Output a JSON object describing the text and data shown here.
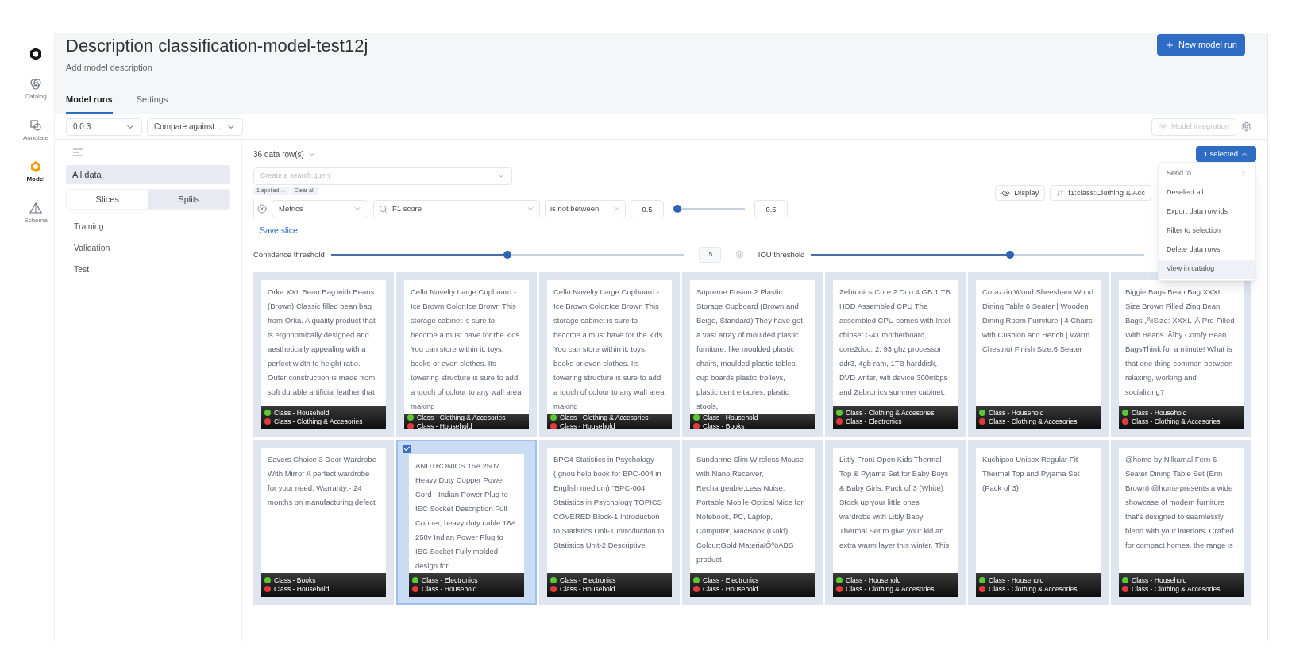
{
  "rail": [
    {
      "label": "Catalog",
      "selected": false,
      "kind": "catalog"
    },
    {
      "label": "Annotate",
      "selected": false,
      "kind": "annotate"
    },
    {
      "label": "Model",
      "selected": true,
      "kind": "model"
    },
    {
      "label": "Schema",
      "selected": false,
      "kind": "schema"
    }
  ],
  "header": {
    "title": "Description classification-model-test12j",
    "subtitle": "Add model description",
    "new_run": "New model run"
  },
  "tabs": [
    {
      "label": "Model runs",
      "selected": true
    },
    {
      "label": "Settings",
      "selected": false
    }
  ],
  "toolbar": {
    "version": "0.0.3",
    "compare": "Compare against...",
    "integration": "Model integration"
  },
  "sidebar": {
    "all_data": "All data",
    "segments": [
      {
        "label": "Slices",
        "selected": false
      },
      {
        "label": "Splits",
        "selected": true
      }
    ],
    "splits": [
      "Training",
      "Validation",
      "Test"
    ]
  },
  "rows_count": "36 data row(s)",
  "search": {
    "placeholder": "Create a search query",
    "applied": "1 applied",
    "clear": "Clear all"
  },
  "filter": {
    "field": "Metrics",
    "metric": "F1 score",
    "operator": "is not between",
    "min": "0.5",
    "max": "0.5",
    "level": 0.0
  },
  "save_slice": "Save slice",
  "display": "Display",
  "sort": "f1:class:Clothing & Acc",
  "selected_button": "1 selected",
  "menu": [
    {
      "label": "Send to",
      "kind": "submenu",
      "selected": false
    },
    {
      "label": "Deselect all",
      "kind": "item",
      "selected": false
    },
    {
      "label": "Export data row ids",
      "kind": "item",
      "selected": false
    },
    {
      "label": "Filter to selection",
      "kind": "item",
      "selected": false
    },
    {
      "label": "Delete data rows",
      "kind": "item",
      "selected": false
    },
    {
      "label": "View in catalog",
      "kind": "item",
      "selected": true
    }
  ],
  "confidence": {
    "label": "Confidence threshold",
    "level": 0.5,
    "value": ".5"
  },
  "iou": {
    "label": "IOU threshold",
    "level": 0.6
  },
  "cards": [
    {
      "text": "Orka XXL Bean Bag with Beans (Brown) Classic filled bean bag from Orka. A quality product that is ergonomically designed and aesthetically appealing with a perfect width to height ratio. Outer construction is made from soft durable artificial leather that",
      "selected": false,
      "labels": [
        {
          "text": "Class - Household",
          "color": "#5cc832"
        },
        {
          "text": "Class - Clothing & Accesories",
          "color": "#e03a3a"
        }
      ]
    },
    {
      "text": "Cello Novelty Large Cupboard - Ice Brown Color:Ice Brown   This storage cabinet is sure to become a must have for the kids. You can store within it, toys, books or even clothes. Its towering structure is sure to add a touch of colour to any wall area making",
      "selected": false,
      "labels": [
        {
          "text": "Class - Clothing & Accesories",
          "color": "#5cc832"
        },
        {
          "text": "Class - Household",
          "color": "#e03a3a"
        }
      ]
    },
    {
      "text": "Cello Novelty Large Cupboard - Ice Brown Color:Ice Brown   This storage cabinet is sure to become a must have for the kids. You can store within it, toys, books or even clothes. Its towering structure is sure to add a touch of colour to any wall area making",
      "selected": false,
      "labels": [
        {
          "text": "Class - Clothing & Accesories",
          "color": "#5cc832"
        },
        {
          "text": "Class - Household",
          "color": "#e03a3a"
        }
      ]
    },
    {
      "text": "Supreme Fusion 2 Plastic Storage Cupboard (Brown and Beige, Standard) They have got a vast array of moulded plastic furniture, like moulded plastic chairs, moulded plastic tables, cup boards plastic trolleys, plastic centre tables, plastic stools,",
      "selected": false,
      "labels": [
        {
          "text": "Class - Household",
          "color": "#5cc832"
        },
        {
          "text": "Class - Books",
          "color": "#e03a3a"
        }
      ]
    },
    {
      "text": "Zebronics Core 2 Duo 4 GB 1 TB HDD Assembled CPU The assembled CPU comes with Intel chipset G41 motherboard, core2duo, 2. 93 ghz processor ddr3, 4gb ram, 1TB harddisk, DVD writer, wifi device 300mbps and Zebronics summer cabinet.",
      "selected": false,
      "labels": [
        {
          "text": "Class - Clothing & Accesories",
          "color": "#5cc832"
        },
        {
          "text": "Class - Electronics",
          "color": "#e03a3a"
        }
      ]
    },
    {
      "text": "Corazzin Wood Sheesham Wood Dining Table 6 Seater | Wooden Dining Room Furniture | 4 Chairs with Cushion and Bench | Warm Chestnut Finish Size:6 Seater",
      "selected": false,
      "labels": [
        {
          "text": "Class - Household",
          "color": "#5cc832"
        },
        {
          "text": "Class - Clothing & Accesories",
          "color": "#e03a3a"
        }
      ]
    },
    {
      "text": "Biggie Bags Bean Bag XXXL Size Brown Filled Zing Bean Bags ‚ÄìSize: XXXL ‚ÄìPre-Filled With Beans ‚Äìby Comfy Bean BagsThink for a minute! What is that one thing common between relaxing, working and socializing?",
      "selected": false,
      "labels": [
        {
          "text": "Class - Household",
          "color": "#5cc832"
        },
        {
          "text": "Class - Clothing & Accesories",
          "color": "#e03a3a"
        }
      ]
    },
    {
      "text": "Savers Choice 3 Door Wardrobe With Mirror A perfect wardrobe for your need. Warranty:- 24 months on manufacturing defect",
      "selected": false,
      "labels": [
        {
          "text": "Class - Books",
          "color": "#5cc832"
        },
        {
          "text": "Class - Household",
          "color": "#e03a3a"
        }
      ]
    },
    {
      "text": "ANDTRONICS 16A 250v Heavy Duty Copper Power Cord - Indian Power Plug to IEC Socket Description Full Copper, heavy duty cable 16A 250v Indian Power Plug to IEC Socket Fully molded design for",
      "selected": true,
      "labels": [
        {
          "text": "Class - Electronics",
          "color": "#5cc832"
        },
        {
          "text": "Class - Household",
          "color": "#e03a3a"
        }
      ]
    },
    {
      "text": "BPC4 Statistics in Psychology (Ignou help book for BPC-004 in English medium) \"BPC-004 Statistics in Psychology TOPICS COVERED Block-1 Introduction to Statistics Unit-1 Introduction to Statistics Unit-2 Descriptive",
      "selected": false,
      "labels": [
        {
          "text": "Class - Electronics",
          "color": "#5cc832"
        },
        {
          "text": "Class - Household",
          "color": "#e03a3a"
        }
      ]
    },
    {
      "text": "Sundarme Slim Wireless Mouse with Nano Receiver, Rechargeable,Less Noise, Portable Mobile Optical Mice for Notebook, PC, Laptop, Computer, MacBook (Gold) Colour:Gold MaterialÔºöABS product",
      "selected": false,
      "labels": [
        {
          "text": "Class - Electronics",
          "color": "#5cc832"
        },
        {
          "text": "Class - Household",
          "color": "#e03a3a"
        }
      ]
    },
    {
      "text": "Littly Front Open Kids Thermal Top & Pyjama Set for Baby Boys & Baby Girls, Pack of 3 (White) Stock up your little ones wardrobe with Littly Baby Thermal Set to give your kid an extra warm layer this winter. This",
      "selected": false,
      "labels": [
        {
          "text": "Class - Household",
          "color": "#5cc832"
        },
        {
          "text": "Class - Clothing & Accesories",
          "color": "#e03a3a"
        }
      ]
    },
    {
      "text": "Kuchipoo Unisex Regular Fit Thermal Top and Pyjama Set (Pack of 3)",
      "selected": false,
      "labels": [
        {
          "text": "Class - Household",
          "color": "#5cc832"
        },
        {
          "text": "Class - Clothing & Accesories",
          "color": "#e03a3a"
        }
      ]
    },
    {
      "text": "@home by Nilkamal Fern  6 Seater Dining Table Set (Erin Brown) @home presents a wide showcase of modern furniture that's designed to seamlessly blend with your interiors. Crafted for compact homes, the range is",
      "selected": false,
      "labels": [
        {
          "text": "Class - Household",
          "color": "#5cc832"
        },
        {
          "text": "Class - Clothing & Accesories",
          "color": "#e03a3a"
        }
      ]
    }
  ]
}
